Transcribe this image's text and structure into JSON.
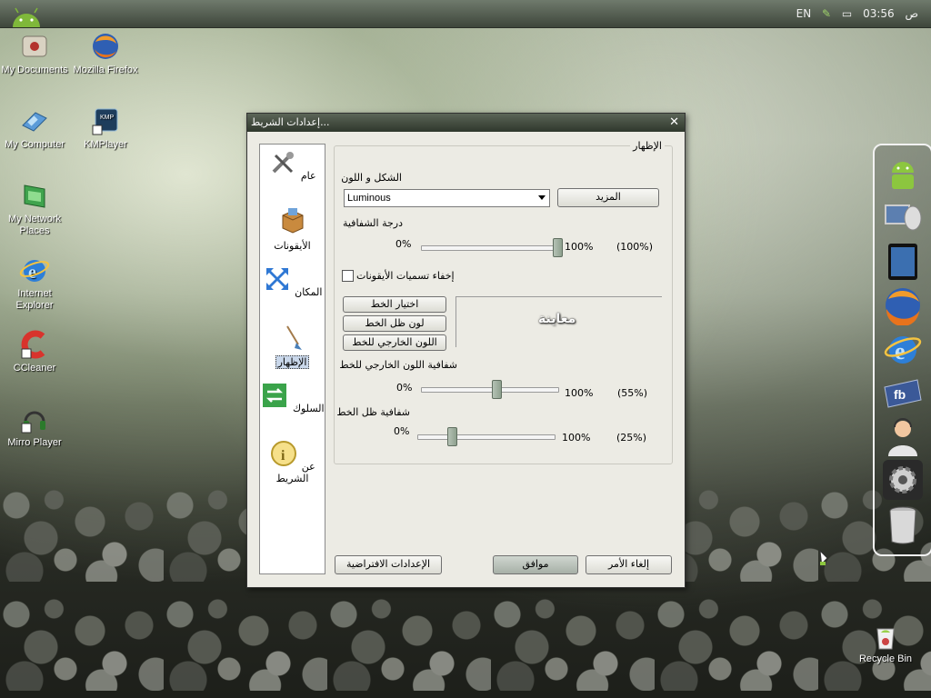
{
  "tray": {
    "lang": "EN",
    "time": "03:56",
    "ampm": "ص"
  },
  "desktop_icons": [
    {
      "label": "My Documents",
      "icon": "my-documents-icon"
    },
    {
      "label": "Mozilla Firefox",
      "icon": "firefox-icon"
    },
    {
      "label": "My Computer",
      "icon": "my-computer-icon"
    },
    {
      "label": "KMPlayer",
      "icon": "kmplayer-icon"
    },
    {
      "label": "My Network Places",
      "icon": "network-places-icon"
    },
    {
      "label": "Internet Explorer",
      "icon": "internet-explorer-icon"
    },
    {
      "label": "CCleaner",
      "icon": "ccleaner-icon"
    },
    {
      "label": "Mirro Player",
      "icon": "mirro-player-icon"
    }
  ],
  "recycle_bin": {
    "label": "Recycle Bin"
  },
  "dialog": {
    "title": "إعدادات الشريط...",
    "sidebar": [
      {
        "label": "عام",
        "icon": "tools-icon"
      },
      {
        "label": "الأيقونات",
        "icon": "icons-box-icon"
      },
      {
        "label": "المكان",
        "icon": "position-arrows-icon"
      },
      {
        "label": "الإظهار",
        "icon": "appearance-brush-icon",
        "selected": true
      },
      {
        "label": "السلوك",
        "icon": "behavior-arrows-icon"
      },
      {
        "label": "عن الشريط",
        "icon": "info-icon"
      }
    ],
    "group_label": "الإظهار",
    "shape_color_label": "الشكل و اللون",
    "theme_value": "Luminous",
    "more_button": "المزيد",
    "opacity_label": "درجة الشفافية",
    "opacity": {
      "min": "0%",
      "max": "100%",
      "value_text": "(100%)",
      "value": 100
    },
    "hide_labels_checkbox": "إخفاء تسميات الأيقونات",
    "font_button": "اختيار الخط",
    "shadow_color_button": "لون ظل الخط",
    "outline_color_button": "اللون الخارجي للخط",
    "preview_text": "معاينة",
    "outline_opacity_label": "شفافية اللون الخارجي للخط",
    "outline_opacity": {
      "min": "0%",
      "max": "100%",
      "value_text": "(55%)",
      "value": 55
    },
    "shadow_opacity_label": "شفافية ظل الخط",
    "shadow_opacity": {
      "min": "0%",
      "max": "100%",
      "value_text": "(25%)",
      "value": 25
    },
    "defaults_button": "الإعدادات الافتراضية",
    "ok_button": "موافق",
    "cancel_button": "إلغاء الأمر"
  },
  "dock_items": [
    "android-icon",
    "monitor-satellite-icon",
    "ipad-icon",
    "firefox-icon",
    "internet-explorer-icon",
    "facebook-icon",
    "support-person-icon",
    "settings-gear-icon",
    "trash-can-icon"
  ]
}
